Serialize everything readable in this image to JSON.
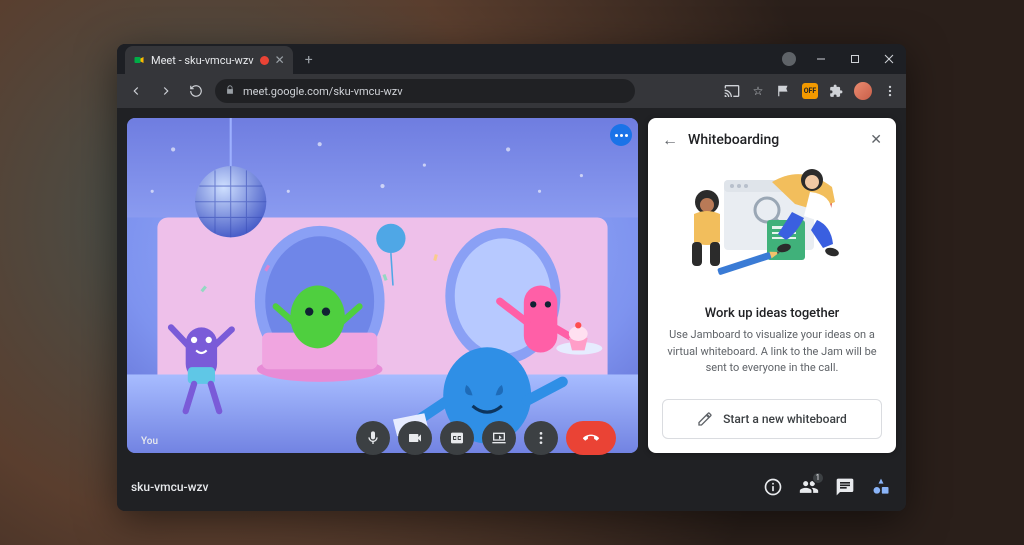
{
  "browser": {
    "tab_title": "Meet - sku-vmcu-wzv",
    "url_display": "meet.google.com/sku-vmcu-wzv"
  },
  "meet": {
    "self_label": "You",
    "meeting_code": "sku-vmcu-wzv",
    "participant_count": "1"
  },
  "panel": {
    "title": "Whiteboarding",
    "heading": "Work up ideas together",
    "description": "Use Jamboard to visualize your ideas on a virtual whiteboard. A link to the Jam will be sent to everyone in the call.",
    "button_label": "Start a new whiteboard"
  },
  "icons": {
    "back": "←",
    "close": "✕",
    "star": "☆",
    "lock": "🔒",
    "plus": "+",
    "ext_off": "OFF"
  }
}
